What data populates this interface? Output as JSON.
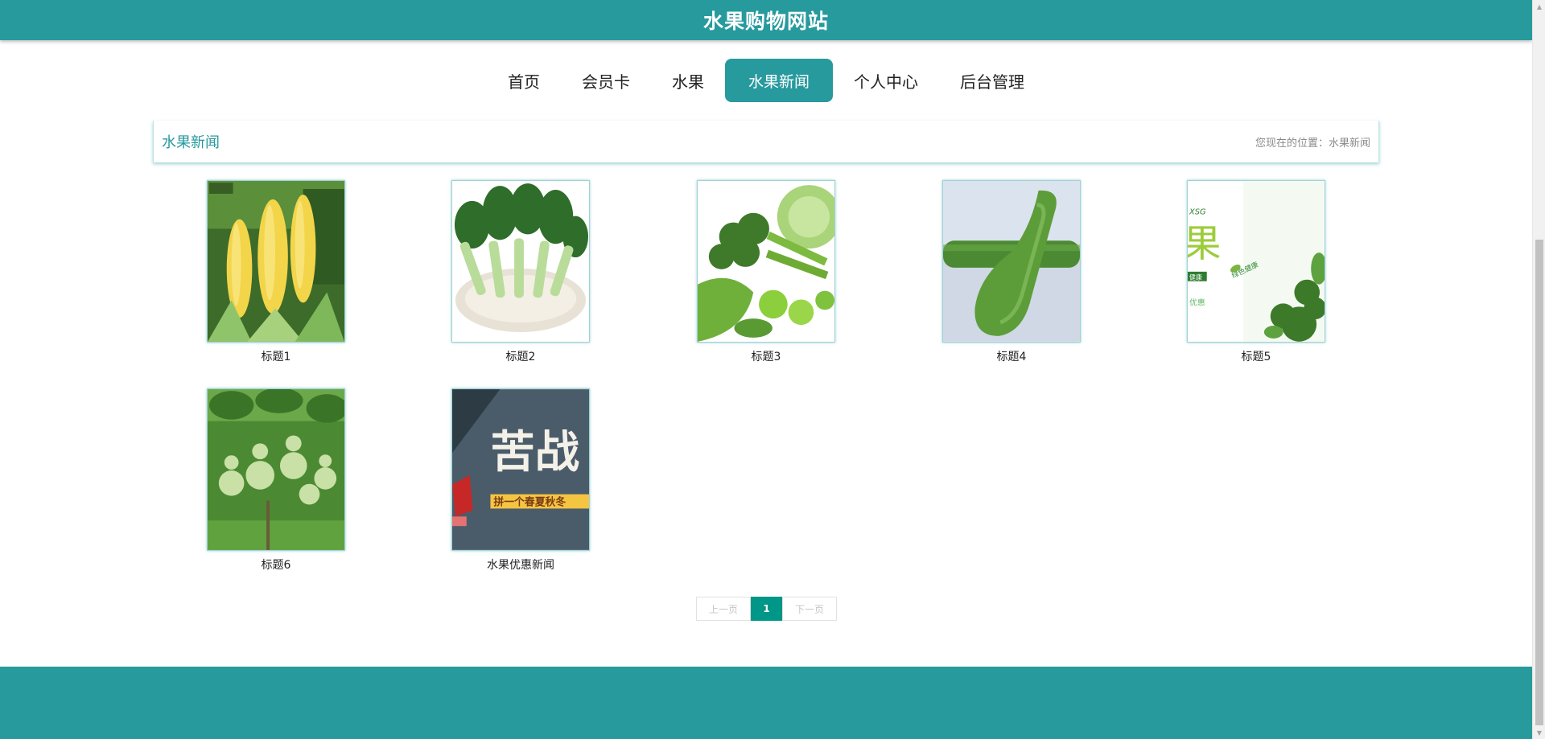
{
  "header": {
    "title": "水果购物网站"
  },
  "nav": {
    "items": [
      {
        "label": "首页"
      },
      {
        "label": "会员卡"
      },
      {
        "label": "水果"
      },
      {
        "label": "水果新闻"
      },
      {
        "label": "个人中心"
      },
      {
        "label": "后台管理"
      }
    ],
    "active_label": "水果新闻"
  },
  "section": {
    "title": "水果新闻",
    "breadcrumb": "您现在的位置：水果新闻"
  },
  "news": [
    {
      "title": "标题1",
      "image": "corn-photo"
    },
    {
      "title": "标题2",
      "image": "bok-choy-photo"
    },
    {
      "title": "标题3",
      "image": "green-vegetables-photo"
    },
    {
      "title": "标题4",
      "image": "cucumber-photo"
    },
    {
      "title": "标题5",
      "image": "fruit-banner-photo"
    },
    {
      "title": "标题6",
      "image": "gourd-vine-photo"
    },
    {
      "title": "水果优惠新闻",
      "image": "promo-poster-photo"
    }
  ],
  "promo_text": {
    "big": "苦战",
    "ribbon": "拼一个春夏秋冬"
  },
  "banner_text": {
    "big": "果",
    "top": "XSG",
    "tag": "健康",
    "sub": "优惠",
    "leaf": "绿色健康"
  },
  "pagination": {
    "prev": "上一页",
    "current": "1",
    "next": "下一页"
  },
  "colors": {
    "brand": "#279a9e",
    "pager_active": "#009688"
  }
}
